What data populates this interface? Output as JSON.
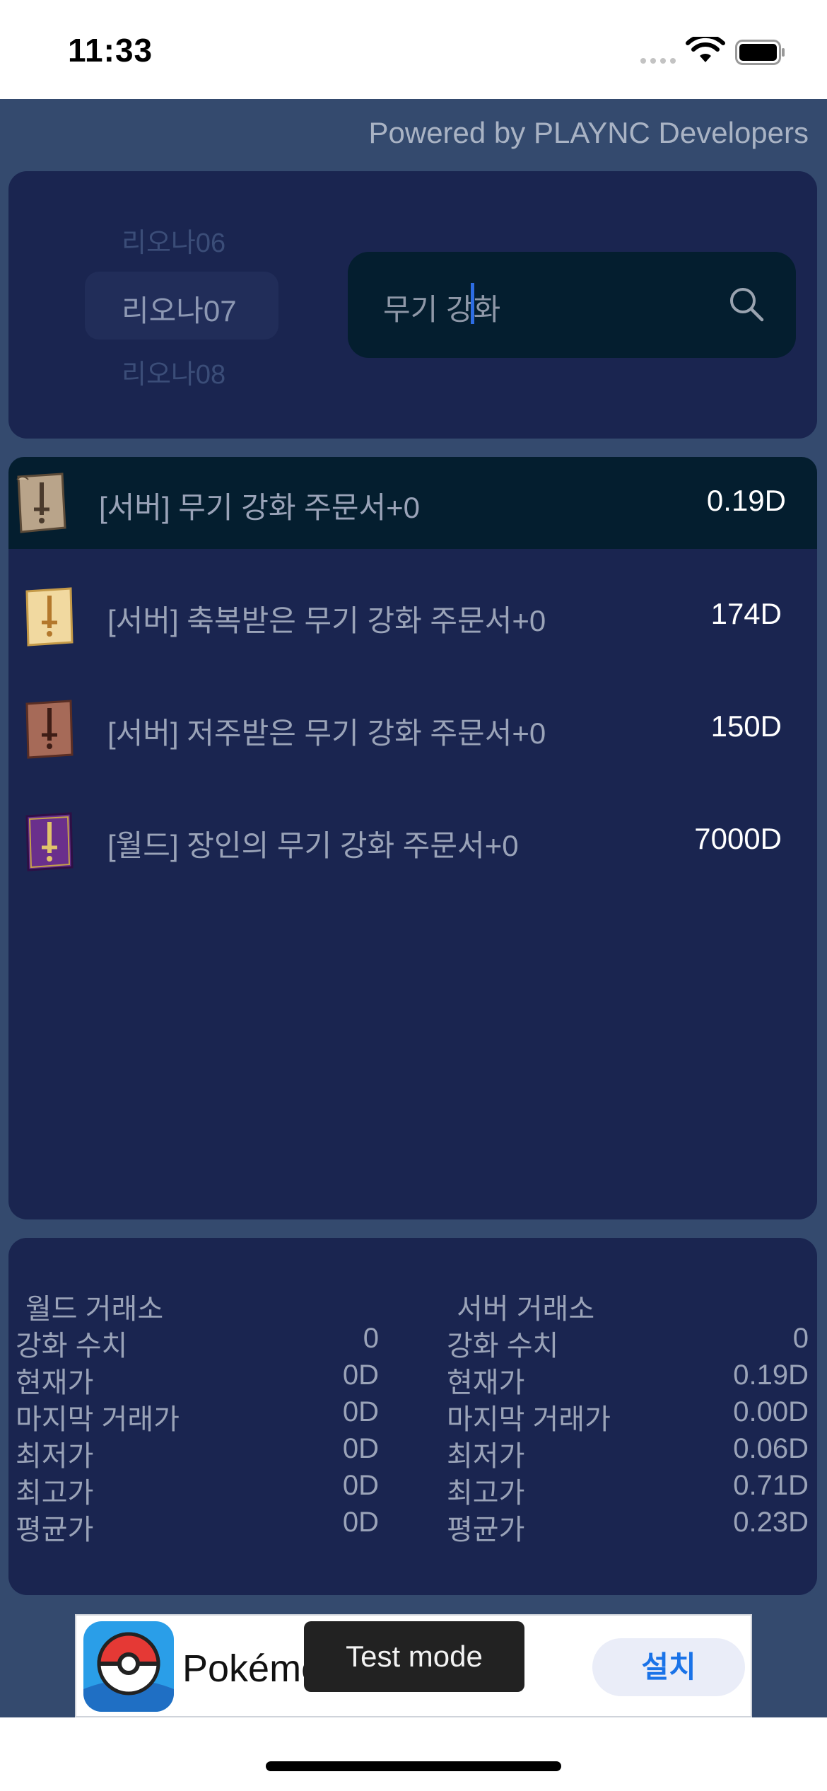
{
  "status_bar": {
    "time": "11:33"
  },
  "header": {
    "powered_by": "Powered by PLAYNC Developers"
  },
  "server_picker": {
    "above": "리오나06",
    "selected": "리오나07",
    "below": "리오나08"
  },
  "search": {
    "value": "무기 강화"
  },
  "items": [
    {
      "name": "[서버] 무기 강화 주문서+0",
      "price": "0.19D",
      "icon": "weapon-scroll-icon",
      "selected": true
    },
    {
      "name": "[서버] 축복받은 무기 강화 주문서+0",
      "price": "174D",
      "icon": "blessed-weapon-scroll-icon",
      "selected": false
    },
    {
      "name": "[서버] 저주받은 무기 강화 주문서+0",
      "price": "150D",
      "icon": "cursed-weapon-scroll-icon",
      "selected": false
    },
    {
      "name": "[월드] 장인의 무기 강화 주문서+0",
      "price": "7000D",
      "icon": "artisan-weapon-scroll-icon",
      "selected": false
    }
  ],
  "world_exchange": {
    "heading": "월드 거래소",
    "rows": [
      {
        "label": "강화 수치",
        "value": "0"
      },
      {
        "label": "현재가",
        "value": "0D"
      },
      {
        "label": "마지막 거래가",
        "value": "0D"
      },
      {
        "label": "최저가",
        "value": "0D"
      },
      {
        "label": "최고가",
        "value": "0D"
      },
      {
        "label": "평균가",
        "value": "0D"
      }
    ]
  },
  "server_exchange": {
    "heading": "서버 거래소",
    "rows": [
      {
        "label": "강화 수치",
        "value": "0"
      },
      {
        "label": "현재가",
        "value": "0.19D"
      },
      {
        "label": "마지막 거래가",
        "value": "0.00D"
      },
      {
        "label": "최저가",
        "value": "0.06D"
      },
      {
        "label": "최고가",
        "value": "0.71D"
      },
      {
        "label": "평균가",
        "value": "0.23D"
      }
    ]
  },
  "ad": {
    "title": "Pokémo",
    "install_label": "설치",
    "test_mode": "Test mode"
  },
  "colors": {
    "background": "#344a6e",
    "panel": "#1a2550",
    "selected_row": "#041e2f",
    "install_text": "#1a73e8"
  }
}
